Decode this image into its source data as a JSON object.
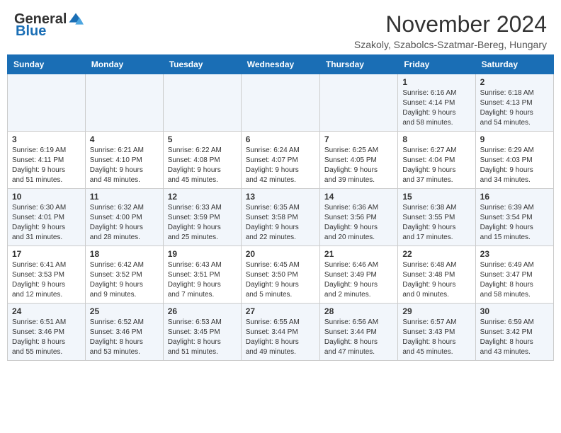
{
  "header": {
    "logo_general": "General",
    "logo_blue": "Blue",
    "month_title": "November 2024",
    "location": "Szakoly, Szabolcs-Szatmar-Bereg, Hungary"
  },
  "days_of_week": [
    "Sunday",
    "Monday",
    "Tuesday",
    "Wednesday",
    "Thursday",
    "Friday",
    "Saturday"
  ],
  "weeks": [
    [
      {
        "day": "",
        "info": ""
      },
      {
        "day": "",
        "info": ""
      },
      {
        "day": "",
        "info": ""
      },
      {
        "day": "",
        "info": ""
      },
      {
        "day": "",
        "info": ""
      },
      {
        "day": "1",
        "info": "Sunrise: 6:16 AM\nSunset: 4:14 PM\nDaylight: 9 hours\nand 58 minutes."
      },
      {
        "day": "2",
        "info": "Sunrise: 6:18 AM\nSunset: 4:13 PM\nDaylight: 9 hours\nand 54 minutes."
      }
    ],
    [
      {
        "day": "3",
        "info": "Sunrise: 6:19 AM\nSunset: 4:11 PM\nDaylight: 9 hours\nand 51 minutes."
      },
      {
        "day": "4",
        "info": "Sunrise: 6:21 AM\nSunset: 4:10 PM\nDaylight: 9 hours\nand 48 minutes."
      },
      {
        "day": "5",
        "info": "Sunrise: 6:22 AM\nSunset: 4:08 PM\nDaylight: 9 hours\nand 45 minutes."
      },
      {
        "day": "6",
        "info": "Sunrise: 6:24 AM\nSunset: 4:07 PM\nDaylight: 9 hours\nand 42 minutes."
      },
      {
        "day": "7",
        "info": "Sunrise: 6:25 AM\nSunset: 4:05 PM\nDaylight: 9 hours\nand 39 minutes."
      },
      {
        "day": "8",
        "info": "Sunrise: 6:27 AM\nSunset: 4:04 PM\nDaylight: 9 hours\nand 37 minutes."
      },
      {
        "day": "9",
        "info": "Sunrise: 6:29 AM\nSunset: 4:03 PM\nDaylight: 9 hours\nand 34 minutes."
      }
    ],
    [
      {
        "day": "10",
        "info": "Sunrise: 6:30 AM\nSunset: 4:01 PM\nDaylight: 9 hours\nand 31 minutes."
      },
      {
        "day": "11",
        "info": "Sunrise: 6:32 AM\nSunset: 4:00 PM\nDaylight: 9 hours\nand 28 minutes."
      },
      {
        "day": "12",
        "info": "Sunrise: 6:33 AM\nSunset: 3:59 PM\nDaylight: 9 hours\nand 25 minutes."
      },
      {
        "day": "13",
        "info": "Sunrise: 6:35 AM\nSunset: 3:58 PM\nDaylight: 9 hours\nand 22 minutes."
      },
      {
        "day": "14",
        "info": "Sunrise: 6:36 AM\nSunset: 3:56 PM\nDaylight: 9 hours\nand 20 minutes."
      },
      {
        "day": "15",
        "info": "Sunrise: 6:38 AM\nSunset: 3:55 PM\nDaylight: 9 hours\nand 17 minutes."
      },
      {
        "day": "16",
        "info": "Sunrise: 6:39 AM\nSunset: 3:54 PM\nDaylight: 9 hours\nand 15 minutes."
      }
    ],
    [
      {
        "day": "17",
        "info": "Sunrise: 6:41 AM\nSunset: 3:53 PM\nDaylight: 9 hours\nand 12 minutes."
      },
      {
        "day": "18",
        "info": "Sunrise: 6:42 AM\nSunset: 3:52 PM\nDaylight: 9 hours\nand 9 minutes."
      },
      {
        "day": "19",
        "info": "Sunrise: 6:43 AM\nSunset: 3:51 PM\nDaylight: 9 hours\nand 7 minutes."
      },
      {
        "day": "20",
        "info": "Sunrise: 6:45 AM\nSunset: 3:50 PM\nDaylight: 9 hours\nand 5 minutes."
      },
      {
        "day": "21",
        "info": "Sunrise: 6:46 AM\nSunset: 3:49 PM\nDaylight: 9 hours\nand 2 minutes."
      },
      {
        "day": "22",
        "info": "Sunrise: 6:48 AM\nSunset: 3:48 PM\nDaylight: 9 hours\nand 0 minutes."
      },
      {
        "day": "23",
        "info": "Sunrise: 6:49 AM\nSunset: 3:47 PM\nDaylight: 8 hours\nand 58 minutes."
      }
    ],
    [
      {
        "day": "24",
        "info": "Sunrise: 6:51 AM\nSunset: 3:46 PM\nDaylight: 8 hours\nand 55 minutes."
      },
      {
        "day": "25",
        "info": "Sunrise: 6:52 AM\nSunset: 3:46 PM\nDaylight: 8 hours\nand 53 minutes."
      },
      {
        "day": "26",
        "info": "Sunrise: 6:53 AM\nSunset: 3:45 PM\nDaylight: 8 hours\nand 51 minutes."
      },
      {
        "day": "27",
        "info": "Sunrise: 6:55 AM\nSunset: 3:44 PM\nDaylight: 8 hours\nand 49 minutes."
      },
      {
        "day": "28",
        "info": "Sunrise: 6:56 AM\nSunset: 3:44 PM\nDaylight: 8 hours\nand 47 minutes."
      },
      {
        "day": "29",
        "info": "Sunrise: 6:57 AM\nSunset: 3:43 PM\nDaylight: 8 hours\nand 45 minutes."
      },
      {
        "day": "30",
        "info": "Sunrise: 6:59 AM\nSunset: 3:42 PM\nDaylight: 8 hours\nand 43 minutes."
      }
    ]
  ]
}
